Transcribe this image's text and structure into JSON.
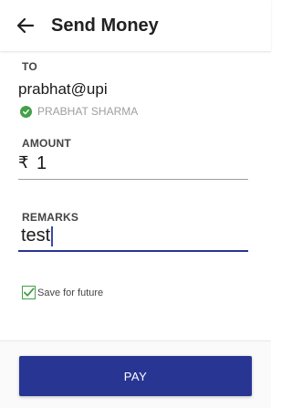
{
  "header": {
    "title": "Send Money",
    "back_icon": "arrow-left-icon"
  },
  "to": {
    "label": "TO",
    "value": "prabhat@upi",
    "verified_name": "PRABHAT SHARMA",
    "verified_icon": "check-circle-icon",
    "verified_color": "#43a047"
  },
  "amount": {
    "label": "AMOUNT",
    "currency_symbol": "₹",
    "value": "1"
  },
  "remarks": {
    "label": "REMARKS",
    "value": "test"
  },
  "save": {
    "label": "Save for future",
    "checked": true
  },
  "pay": {
    "label": "PAY",
    "color": "#283593"
  }
}
